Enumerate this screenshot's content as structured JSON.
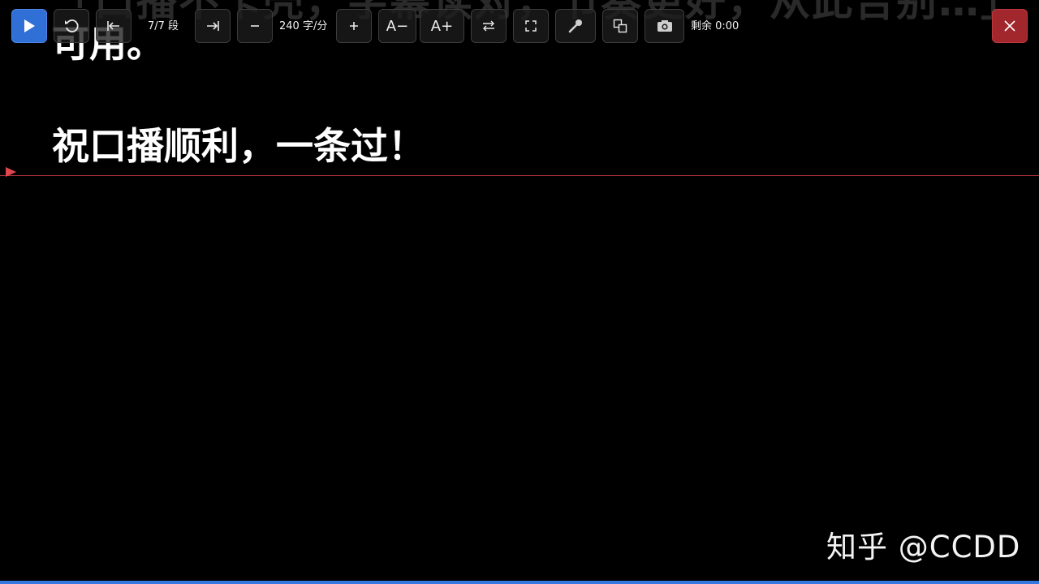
{
  "script": {
    "faded_line": "「口播不卡壳，字幕读对，节奏更好，从此告别…」",
    "previous_paragraph_end": "可用。",
    "current_paragraph": "祝口播顺利，一条过！"
  },
  "toolbar": {
    "play_label": "play",
    "segment_counter": "7/7 段",
    "speed_value": "240 字/分",
    "font_decrease_label": "A−",
    "font_increase_label": "A+",
    "remaining_time": "剩余 0:00",
    "icons": {
      "play": "play-icon",
      "restart": "restart-icon",
      "prev_segment": "skip-to-start-icon",
      "next_segment": "skip-to-end-icon",
      "speed_down": "minus-icon",
      "speed_up": "plus-icon",
      "mirror": "mirror-icon",
      "fullscreen": "fullscreen-icon",
      "mic": "microphone-icon",
      "pip": "picture-in-picture-icon",
      "camera": "camera-icon",
      "close": "close-icon"
    }
  },
  "progress": {
    "fraction": 1.0
  },
  "watermark": {
    "text": "知乎 @CCDD"
  },
  "colors": {
    "play_button": "#2f6fd6",
    "close_button": "#a1272c",
    "guide_line": "#b0343a",
    "progress": "#3478e0",
    "background": "#000000"
  }
}
